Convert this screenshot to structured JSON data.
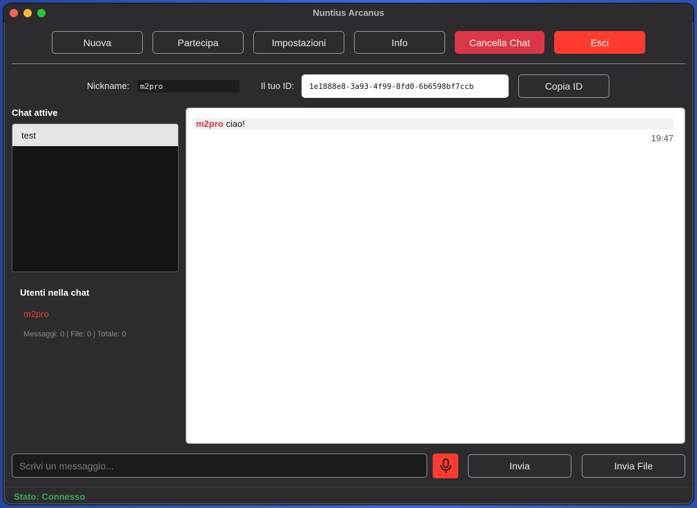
{
  "window": {
    "title": "Nuntius Arcanus"
  },
  "toolbar": {
    "new_label": "Nuova",
    "join_label": "Partecipa",
    "settings_label": "Impostazioni",
    "info_label": "Info",
    "delete_chat_label": "Cancella Chat",
    "exit_label": "Esci"
  },
  "identity": {
    "nickname_label": "Nickname:",
    "nickname_value": "m2pro",
    "id_label": "Il tuo ID:",
    "id_value": "1e1888e8-3a93-4f99-8fd0-6b6598bf7ccb",
    "copy_id_label": "Copia ID"
  },
  "sidebar": {
    "chats_title": "Chat attive",
    "chats": [
      {
        "label": "test"
      }
    ],
    "users_title": "Utenti nella chat",
    "users": [
      {
        "name": "m2pro"
      }
    ],
    "stats": "Messaggi: 0 | File: 0 | Totale: 0"
  },
  "messages": [
    {
      "author": "m2pro",
      "text": "ciao!",
      "time": "19:47"
    }
  ],
  "composer": {
    "placeholder": "Scrivi un messaggio...",
    "mic_icon": "microphone-icon",
    "send_label": "Invia",
    "send_file_label": "Invia File"
  },
  "status": {
    "text": "Stato: Connesso"
  },
  "colors": {
    "accent_red": "#ff3b30",
    "delete_red": "#dc3545",
    "status_green": "#34a853"
  }
}
